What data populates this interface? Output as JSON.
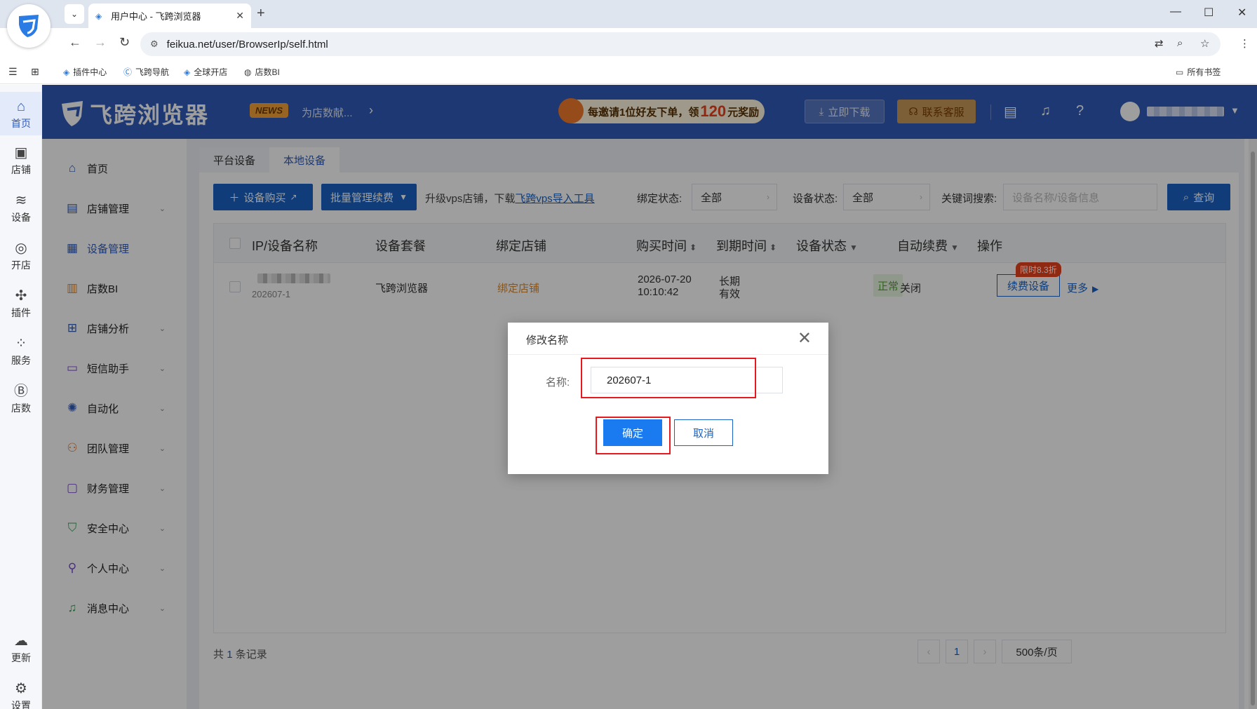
{
  "browser": {
    "tab_title": "用户中心 - 飞跨浏览器",
    "url": "feikua.net/user/BrowserIp/self.html",
    "bookmarks": [
      "插件中心",
      "飞跨导航",
      "全球开店",
      "店数BI"
    ],
    "all_bookmarks": "所有书签"
  },
  "header": {
    "logo": "飞跨浏览器",
    "news_badge": "NEWS",
    "news_text": "为店数献...",
    "promo_prefix": "每邀请1位好友下单，领",
    "promo_amount": "120",
    "promo_suffix": "元奖励",
    "download_label": "立即下载",
    "service_label": "联系客服"
  },
  "rail": [
    {
      "label": "首页",
      "icon": "home-icon"
    },
    {
      "label": "店铺",
      "icon": "store-icon"
    },
    {
      "label": "设备",
      "icon": "layers-icon"
    },
    {
      "label": "开店",
      "icon": "globe-icon"
    },
    {
      "label": "插件",
      "icon": "puzzle-icon"
    },
    {
      "label": "服务",
      "icon": "grid-icon"
    },
    {
      "label": "店数",
      "icon": "bi-icon"
    },
    {
      "label": "更新",
      "icon": "cloud-icon"
    },
    {
      "label": "设置",
      "icon": "gear-icon"
    }
  ],
  "sidebar": {
    "items": [
      {
        "label": "首页"
      },
      {
        "label": "店铺管理"
      },
      {
        "label": "设备管理"
      },
      {
        "label": "店数BI"
      },
      {
        "label": "店铺分析"
      },
      {
        "label": "短信助手"
      },
      {
        "label": "自动化"
      },
      {
        "label": "团队管理"
      },
      {
        "label": "财务管理"
      },
      {
        "label": "安全中心"
      },
      {
        "label": "个人中心"
      },
      {
        "label": "消息中心"
      }
    ]
  },
  "main": {
    "tabs": [
      "平台设备",
      "本地设备"
    ],
    "buy_device": "设备购买",
    "batch_renew": "批量管理续费",
    "upgrade_text": "升级vps店铺，下载",
    "import_link": "飞跨vps导入工具",
    "bind_status_label": "绑定状态:",
    "bind_status_value": "全部",
    "device_status_label": "设备状态:",
    "device_status_value": "全部",
    "keyword_label": "关键词搜索:",
    "keyword_placeholder": "设备名称/设备信息",
    "search_label": "查询",
    "columns": [
      "IP/设备名称",
      "设备套餐",
      "绑定店铺",
      "购买时间",
      "到期时间",
      "设备状态",
      "自动续费",
      "操作"
    ],
    "rows": [
      {
        "device_id": "202607-1",
        "package": "飞跨浏览器",
        "bind": "绑定店铺",
        "buy_date": "2026-07-20",
        "buy_time": "10:10:42",
        "expire_1": "长期",
        "expire_2": "有效",
        "status": "正常",
        "auto_renew": "关闭",
        "renew_btn": "续费设备",
        "discount": "限时8.3折",
        "more": "更多"
      }
    ],
    "total_prefix": "共",
    "total_count": "1",
    "total_suffix": "条记录",
    "page": "1",
    "page_size": "500条/页"
  },
  "dialog": {
    "title": "修改名称",
    "name_label": "名称:",
    "name_value": "202607-1",
    "ok": "确定",
    "cancel": "取消"
  }
}
